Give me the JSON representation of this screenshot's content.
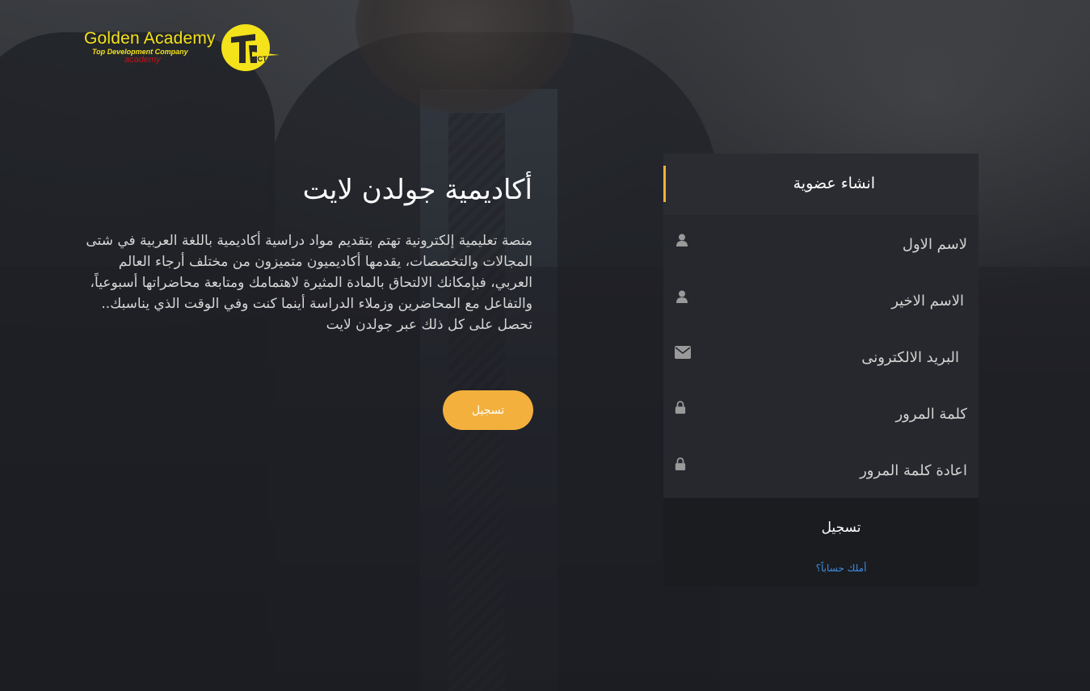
{
  "logo": {
    "title": "Golden Academy",
    "subtitle": "Top Development Company",
    "tagline": "academy",
    "mark_letters": "ICT"
  },
  "hero": {
    "title": "أكاديمية جولدن لايت",
    "description": "منصة تعليمية إلكترونية تهتم بتقديم مواد دراسية أكاديمية باللغة العربية في شتى المجالات والتخصصات، يقدمها أكاديميون متميزون من مختلف أرجاء العالم العربي، فبإمكانك الالتحاق بالمادة المثيرة لاهتمامك ومتابعة محاضراتها أسبوعياً، والتفاعل مع المحاضرين وزملاء الدراسة أينما كنت وفي الوقت الذي يناسبك.. تحصل على كل ذلك عبر جولدن لايت",
    "button_label": "تسجيل"
  },
  "signup": {
    "title": "انشاء عضوية",
    "fields": {
      "first_name": {
        "placeholder": "لاسم الاول",
        "value": "",
        "icon": "user-icon"
      },
      "last_name": {
        "placeholder": "الاسم الاخير",
        "value": "",
        "icon": "user-icon"
      },
      "email": {
        "placeholder": "البريد الالكترونى",
        "value": "",
        "icon": "envelope-icon"
      },
      "password": {
        "placeholder": "كلمة المرور",
        "value": "",
        "icon": "lock-icon"
      },
      "confirm_password": {
        "placeholder": "اعادة كلمة المرور",
        "value": "",
        "icon": "lock-icon"
      }
    },
    "submit_label": "تسجيل",
    "login_link": "أملك حساباً؟"
  },
  "colors": {
    "accent": "#f3b03d",
    "link": "#3f8de0",
    "logo_yellow": "#f4e21a",
    "logo_red": "#c4141a",
    "panel_bg": "#27282d",
    "panel_header_bg": "#2b2c31",
    "submit_bg": "#1b1c20"
  }
}
